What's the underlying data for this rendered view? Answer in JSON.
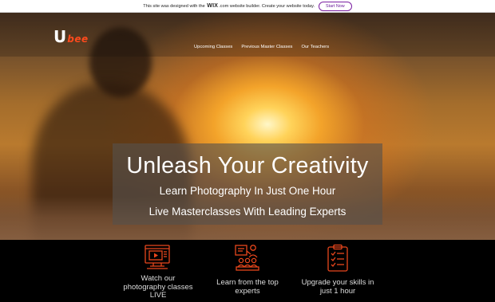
{
  "banner": {
    "text_before": "This site was designed with the",
    "brand": "WIX",
    "text_after": ".com website builder. Create your website today.",
    "button_label": "Start Now"
  },
  "logo": {
    "letter": "U",
    "rest": "bee"
  },
  "nav": {
    "items": [
      "Upcoming Classes",
      "Previous Master Classes",
      "Our Teachers"
    ]
  },
  "hero": {
    "title": "Unleash Your Creativity",
    "subtitle_1": "Learn Photography In Just One Hour",
    "subtitle_2": "Live Masterclasses With Leading Experts"
  },
  "features": [
    {
      "icon": "video-player-icon",
      "label": "Watch our photography classes LIVE"
    },
    {
      "icon": "teacher-presentation-icon",
      "label": "Learn from the top experts"
    },
    {
      "icon": "checklist-clipboard-icon",
      "label": "Upgrade your skills in just 1 hour"
    }
  ],
  "colors": {
    "accent": "#ff4a1c",
    "icon_stroke": "#e8461c",
    "button_border": "#7b1fa2"
  }
}
